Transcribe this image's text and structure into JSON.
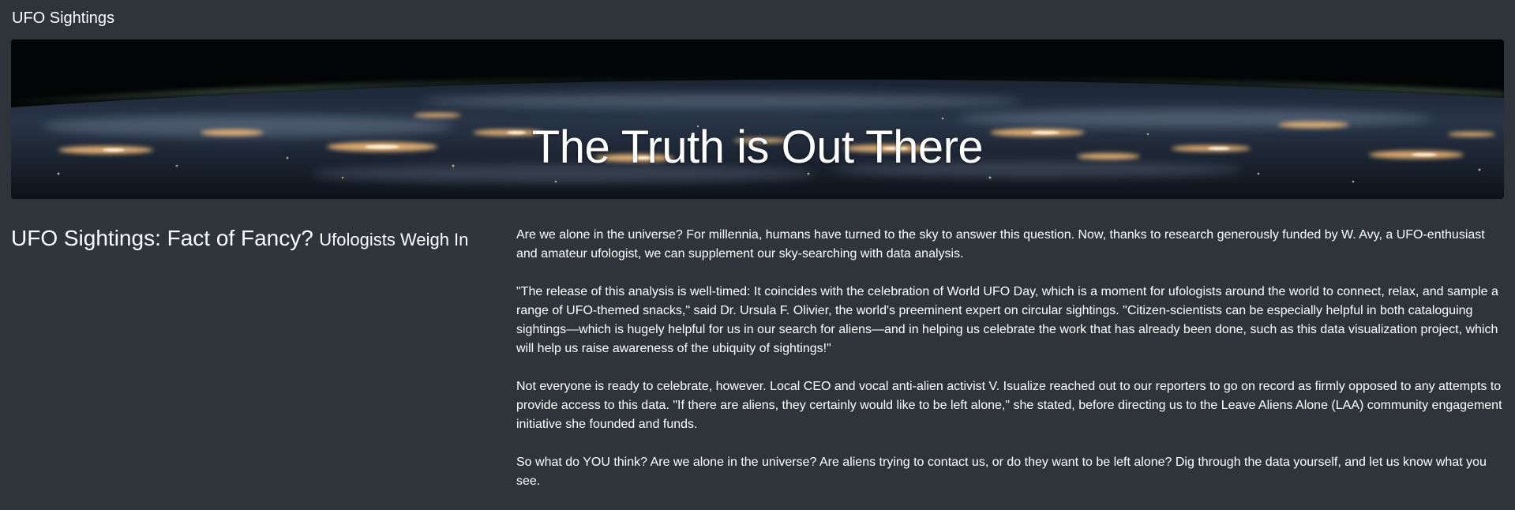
{
  "navbar": {
    "brand": "UFO Sightings"
  },
  "hero": {
    "title": "The Truth is Out There",
    "image": "earth-at-night-from-orbit"
  },
  "headline": {
    "main": "UFO Sightings: Fact of Fancy?",
    "sub": "Ufologists Weigh In"
  },
  "article": {
    "paragraphs": [
      "Are we alone in the universe? For millennia, humans have turned to the sky to answer this question. Now, thanks to research generously funded by W. Avy, a UFO-enthusiast and amateur ufologist, we can supplement our sky-searching with data analysis.",
      "\"The release of this analysis is well-timed: It coincides with the celebration of World UFO Day, which is a moment for ufologists around the world to connect, relax, and sample a range of UFO-themed snacks,\" said Dr. Ursula F. Olivier, the world's preeminent expert on circular sightings. \"Citizen-scientists can be especially helpful in both cataloguing sightings—which is hugely helpful for us in our search for aliens—and in helping us celebrate the work that has already been done, such as this data visualization project, which will help us raise awareness of the ubiquity of sightings!\"",
      "Not everyone is ready to celebrate, however. Local CEO and vocal anti-alien activist V. Isualize reached out to our reporters to go on record as firmly opposed to any attempts to provide access to this data. \"If there are aliens, they certainly would like to be left alone,\" she stated, before directing us to the Leave Aliens Alone (LAA) community engagement initiative she founded and funds.",
      "So what do YOU think? Are we alone in the universe? Are aliens trying to contact us, or do they want to be left alone? Dig through the data yourself, and let us know what you see."
    ]
  },
  "colors": {
    "page_background": "#2f343b",
    "text": "#ffffff",
    "city_lights": "#ffc27a"
  }
}
